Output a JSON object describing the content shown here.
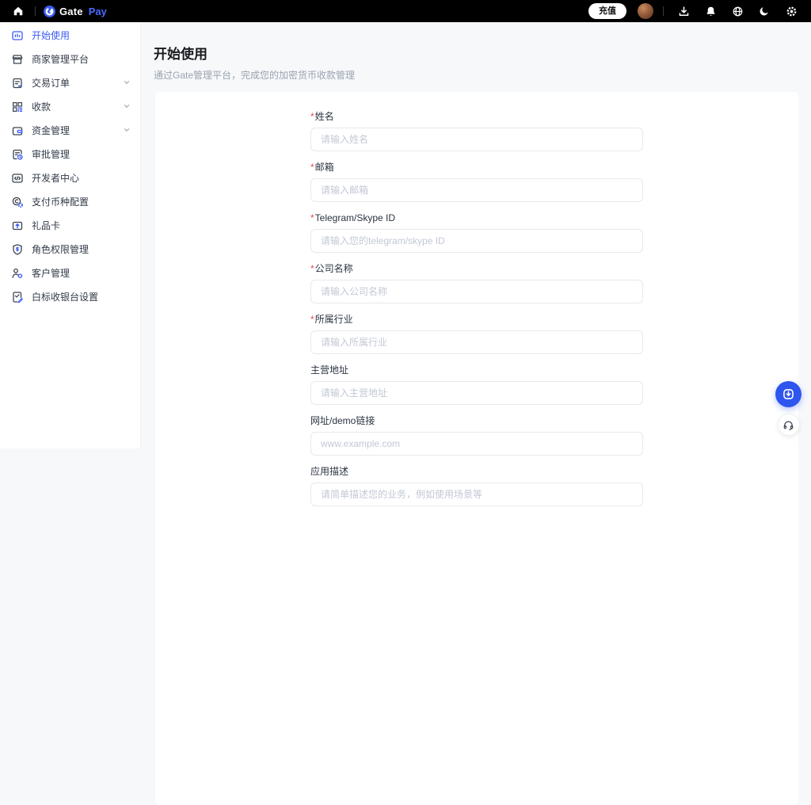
{
  "colors": {
    "accent_blue": "#3b5bf6",
    "header_bg": "#000000",
    "page_bg": "#f7f8fa",
    "card_bg": "#ffffff",
    "required_red": "#e34850",
    "fab_blue": "#2e56ee"
  },
  "header": {
    "left_icons": [
      "home-icon",
      "gate-logo-icon"
    ],
    "logo": {
      "gate": "Gate",
      "pay": "Pay"
    },
    "recharge_label": "充值",
    "right_icons": [
      "avatar",
      "download-icon",
      "bell-icon",
      "globe-icon",
      "moon-icon",
      "gear-icon"
    ]
  },
  "sidebar": {
    "items": [
      {
        "label": "开始使用",
        "icon": "getting-started-icon",
        "active": true,
        "expandable": false
      },
      {
        "label": "商家管理平台",
        "icon": "storefront-icon",
        "active": false,
        "expandable": false
      },
      {
        "label": "交易订单",
        "icon": "order-document-icon",
        "active": false,
        "expandable": true
      },
      {
        "label": "收款",
        "icon": "qr-code-icon",
        "active": false,
        "expandable": true
      },
      {
        "label": "资金管理",
        "icon": "wallet-icon",
        "active": false,
        "expandable": true
      },
      {
        "label": "审批管理",
        "icon": "approval-clock-icon",
        "active": false,
        "expandable": false
      },
      {
        "label": "开发者中心",
        "icon": "code-icon",
        "active": false,
        "expandable": false
      },
      {
        "label": "支付币种配置",
        "icon": "coin-gear-icon",
        "active": false,
        "expandable": false
      },
      {
        "label": "礼品卡",
        "icon": "gift-card-icon",
        "active": false,
        "expandable": false
      },
      {
        "label": "角色权限管理",
        "icon": "shield-icon",
        "active": false,
        "expandable": false
      },
      {
        "label": "客户管理",
        "icon": "customers-icon",
        "active": false,
        "expandable": false
      },
      {
        "label": "白标收银台设置",
        "icon": "edit-document-icon",
        "active": false,
        "expandable": false
      }
    ]
  },
  "main": {
    "title": "开始使用",
    "subtitle": "通过Gate管理平台，完成您的加密货币收款管理",
    "form": {
      "required_marker": "*",
      "fields": [
        {
          "label": "姓名",
          "required": true,
          "placeholder": "请输入姓名"
        },
        {
          "label": "邮箱",
          "required": true,
          "placeholder": "请输入邮箱"
        },
        {
          "label": "Telegram/Skype ID",
          "required": true,
          "placeholder": "请输入您的telegram/skype ID"
        },
        {
          "label": "公司名称",
          "required": true,
          "placeholder": "请输入公司名称"
        },
        {
          "label": "所属行业",
          "required": true,
          "placeholder": "请输入所属行业"
        },
        {
          "label": "主营地址",
          "required": false,
          "placeholder": "请输入主营地址"
        },
        {
          "label": "网址/demo链接",
          "required": false,
          "placeholder": "www.example.com"
        },
        {
          "label": "应用描述",
          "required": false,
          "placeholder": "请简单描述您的业务，例如使用场景等"
        }
      ]
    }
  },
  "fab": {
    "icons": [
      "download-circle-icon",
      "headset-icon"
    ]
  }
}
